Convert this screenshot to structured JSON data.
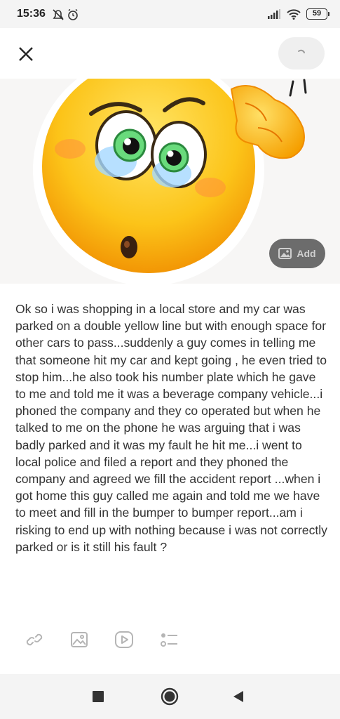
{
  "status_bar": {
    "time": "15:36",
    "battery": "59",
    "icons": [
      "do-not-disturb-icon",
      "alarm-icon",
      "signal-icon",
      "wifi-icon",
      "battery-icon"
    ]
  },
  "top_bar": {
    "close_icon": "close-icon",
    "post_icon": "loading-icon"
  },
  "image": {
    "description_icon": "worried-emoji-sticker",
    "add_button_label": "Add"
  },
  "post": {
    "body": "Ok so i was shopping in a local store and my car was parked on a double yellow line but with enough space for other cars to pass...suddenly a guy comes in telling me that someone hit my car and kept going , he even tried to stop him...he also took his number plate which he gave to me and told me it was a beverage company vehicle...i phoned the company and they co operated but when he talked to me on the phone he was arguing that i was badly parked and it was my fault he hit me...i went to local police and filed a report and they phoned the company and agreed we fill the accident report ...when i got home this guy called me again and told me we have to meet and fill in the bumper to bumper report...am i risking to end up with nothing because i was not correctly parked or is it still his fault ?"
  },
  "toolbar": {
    "items": [
      "link-icon",
      "image-icon",
      "video-icon",
      "list-icon"
    ]
  },
  "nav_bar": {
    "items": [
      "recents-button",
      "home-button",
      "back-button"
    ]
  },
  "colors": {
    "status_bg": "#f4f4f4",
    "add_button_bg": "#6c6c6c",
    "text": "#333333",
    "icon_gray": "#b5b5b5"
  }
}
